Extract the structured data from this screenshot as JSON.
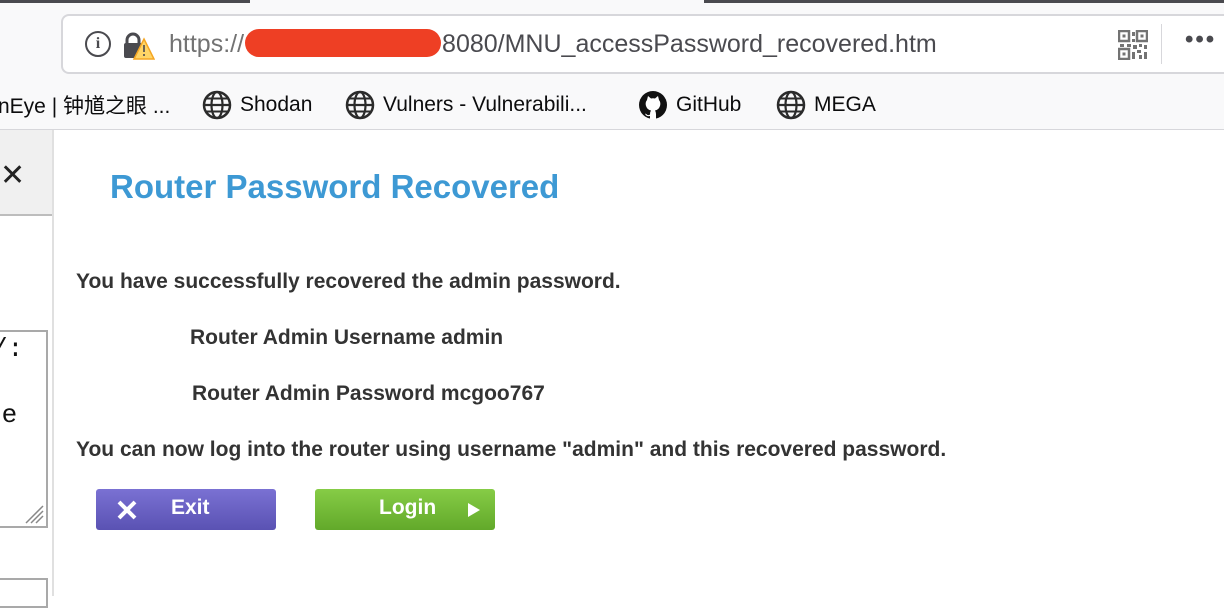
{
  "browser": {
    "url": {
      "scheme": "https://",
      "path": "8080/MNU_accessPassword_recovered.htm"
    },
    "bookmarks": [
      {
        "label": "nEye | 钟馗之眼 ...",
        "icon": "none"
      },
      {
        "label": "Shodan",
        "icon": "globe-icon"
      },
      {
        "label": "Vulners - Vulnerabili...",
        "icon": "globe-icon"
      },
      {
        "label": "GitHub",
        "icon": "github-icon"
      },
      {
        "label": "MEGA",
        "icon": "globe-icon"
      }
    ]
  },
  "sidepanel": {
    "close_glyph": "✕",
    "line1": "/:",
    "line2": "re"
  },
  "page": {
    "title": "Router Password Recovered",
    "success_message": "You have successfully recovered the admin password.",
    "username_line": "Router Admin Username admin",
    "password_line": "Router Admin Password mcgoo767",
    "info_message": "You can now log into the router using username \"admin\" and this recovered password.",
    "exit_label": "Exit",
    "login_label": "Login"
  },
  "colors": {
    "title": "#3d99d4",
    "exit_button": "#6a62c4",
    "login_button": "#74bb37",
    "redaction": "#ee3f24"
  }
}
